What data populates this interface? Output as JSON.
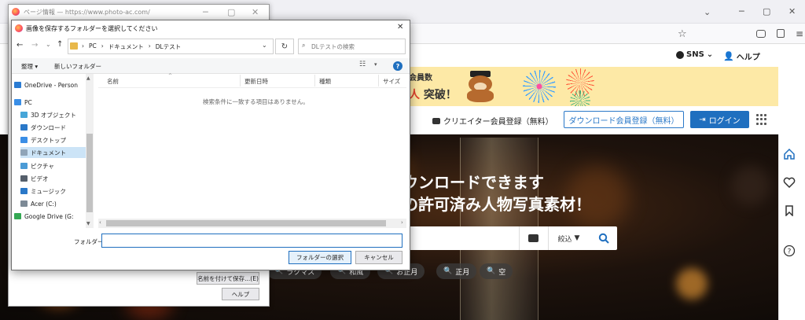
{
  "browser": {
    "minimize": "─",
    "maximize": "▢",
    "close": "✕",
    "tab_chevron": "⌄",
    "star": "☆"
  },
  "site": {
    "sns_label": "SNS",
    "help_label": "ヘルプ",
    "banner_line1": "会員数",
    "banner_line2_red": "人",
    "banner_line2": "突破！",
    "creator_link": "クリエイター会員登録（無料）",
    "download_register": "ダウンロード会員登録（無料）",
    "login": "ログイン",
    "hero_line1": "ウンロードできます",
    "hero_line2": "の許可済み人物写真素材！",
    "filter_label": "絞込",
    "tags": [
      "ラクマス",
      "和風",
      "お正月",
      "正月",
      "空"
    ],
    "accent_color": "#1f6fbf"
  },
  "pageinfo": {
    "title": "ページ情報 — https://www.photo-ac.com/",
    "save_as": "名前を付けて保存...(E)",
    "help": "ヘルプ"
  },
  "dialog": {
    "title": "画像を保存するフォルダーを選択してください",
    "path": [
      "PC",
      "ドキュメント",
      "DLテスト"
    ],
    "search_placeholder": "DLテストの検索",
    "organize": "整理 ▾",
    "new_folder": "新しいフォルダー",
    "nav_items": [
      {
        "label": "OneDrive - Person",
        "icon": "onedrive-icon",
        "color": "#2b7cd3"
      },
      {
        "label": "PC",
        "icon": "pc-icon",
        "color": "#3a8ee6"
      },
      {
        "label": "3D オブジェクト",
        "icon": "3d-objects-icon",
        "color": "#47a6d8"
      },
      {
        "label": "ダウンロード",
        "icon": "download-icon",
        "color": "#2a78c8"
      },
      {
        "label": "デスクトップ",
        "icon": "desktop-icon",
        "color": "#3a8ee6"
      },
      {
        "label": "ドキュメント",
        "icon": "documents-icon",
        "color": "#8fa4b8"
      },
      {
        "label": "ピクチャ",
        "icon": "pictures-icon",
        "color": "#4b9bd6"
      },
      {
        "label": "ビデオ",
        "icon": "videos-icon",
        "color": "#555f6b"
      },
      {
        "label": "ミュージック",
        "icon": "music-icon",
        "color": "#2a78c8"
      },
      {
        "label": "Acer (C:)",
        "icon": "drive-icon",
        "color": "#7d8a96"
      },
      {
        "label": "Google Drive (G:",
        "icon": "google-drive-icon",
        "color": "#34a853"
      }
    ],
    "columns": [
      "名前",
      "更新日時",
      "種類",
      "サイズ"
    ],
    "empty_message": "検索条件に一致する項目はありません。",
    "folder_label": "フォルダー:",
    "folder_value": "",
    "select_folder": "フォルダーの選択",
    "cancel": "キャンセル"
  }
}
